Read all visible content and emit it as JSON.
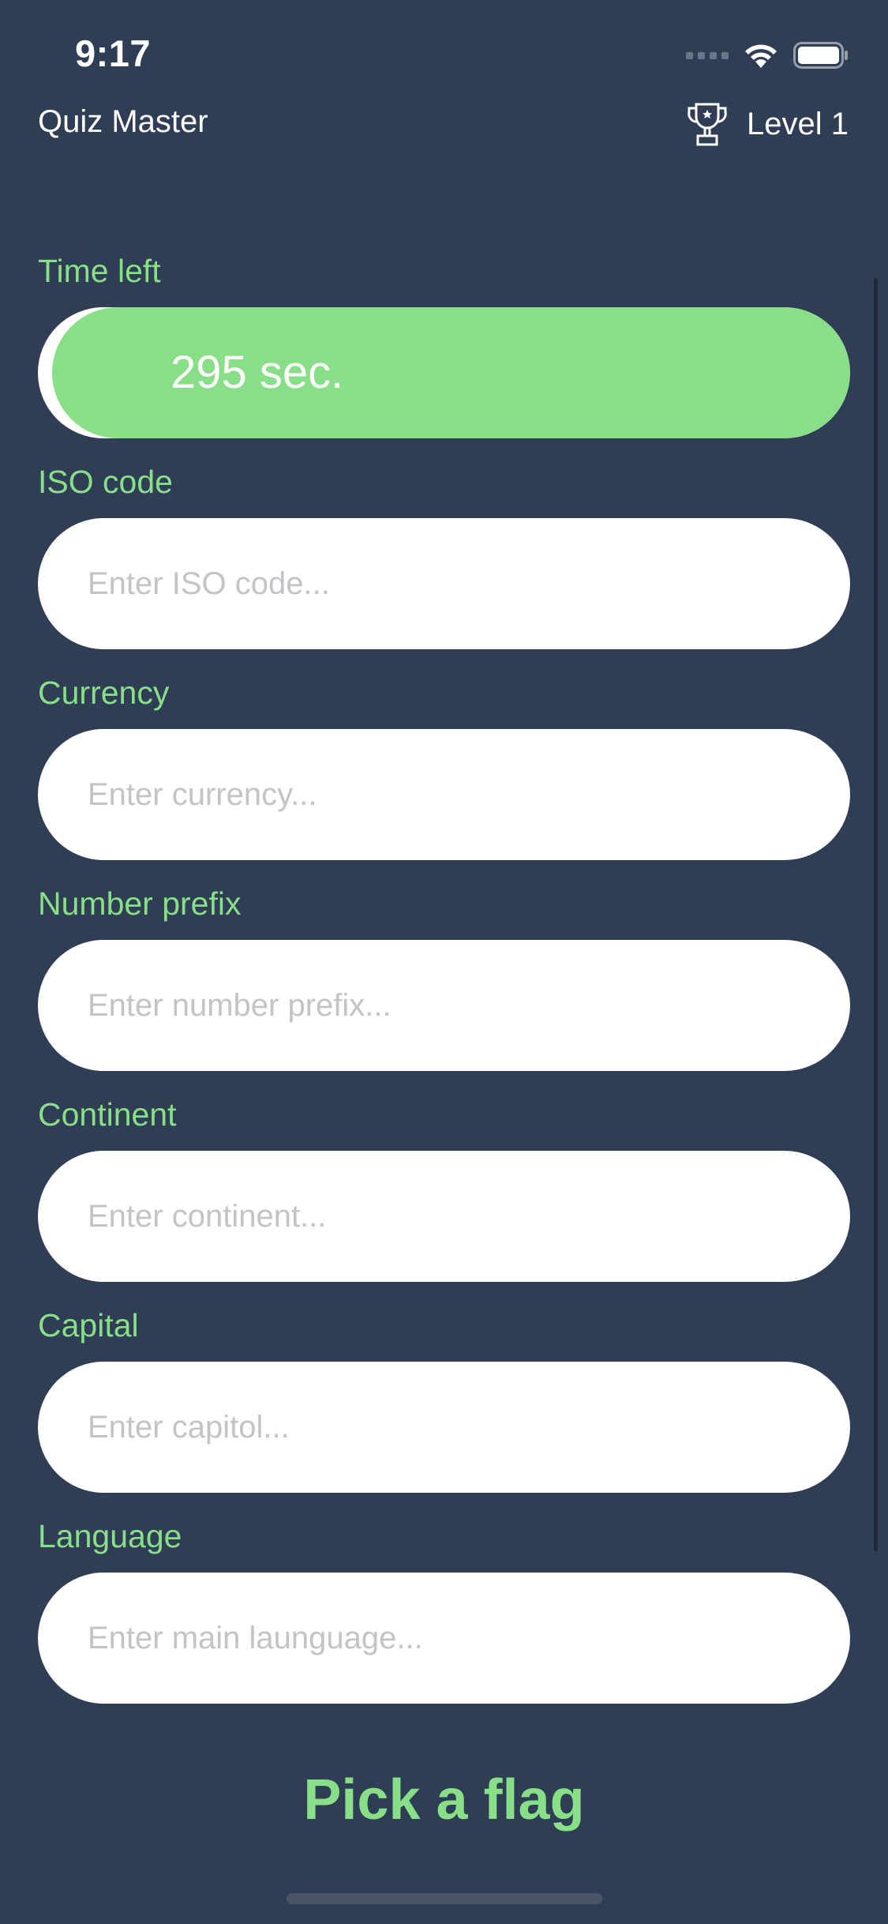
{
  "status_bar": {
    "time": "9:17",
    "icons": [
      "signal-icon",
      "wifi-icon",
      "battery-icon"
    ]
  },
  "header": {
    "app_title": "Quiz Master",
    "level_label": "Level 1",
    "icon": "trophy-icon"
  },
  "timer": {
    "label": "Time left",
    "value_text": "295 sec.",
    "remaining_fraction": 0.983
  },
  "fields": [
    {
      "label": "ISO code",
      "placeholder": "Enter ISO code...",
      "value": ""
    },
    {
      "label": "Currency",
      "placeholder": "Enter currency...",
      "value": ""
    },
    {
      "label": "Number prefix",
      "placeholder": "Enter number prefix...",
      "value": ""
    },
    {
      "label": "Continent",
      "placeholder": "Enter continent...",
      "value": ""
    },
    {
      "label": "Capital",
      "placeholder": "Enter capitol...",
      "value": ""
    },
    {
      "label": "Language",
      "placeholder": "Enter main launguage...",
      "value": ""
    }
  ],
  "cta": {
    "label": "Pick a flag"
  },
  "colors": {
    "background": "#2f3d55",
    "accent_green": "#88df87",
    "field_background": "#ffffff",
    "placeholder": "#c3c3c8"
  }
}
